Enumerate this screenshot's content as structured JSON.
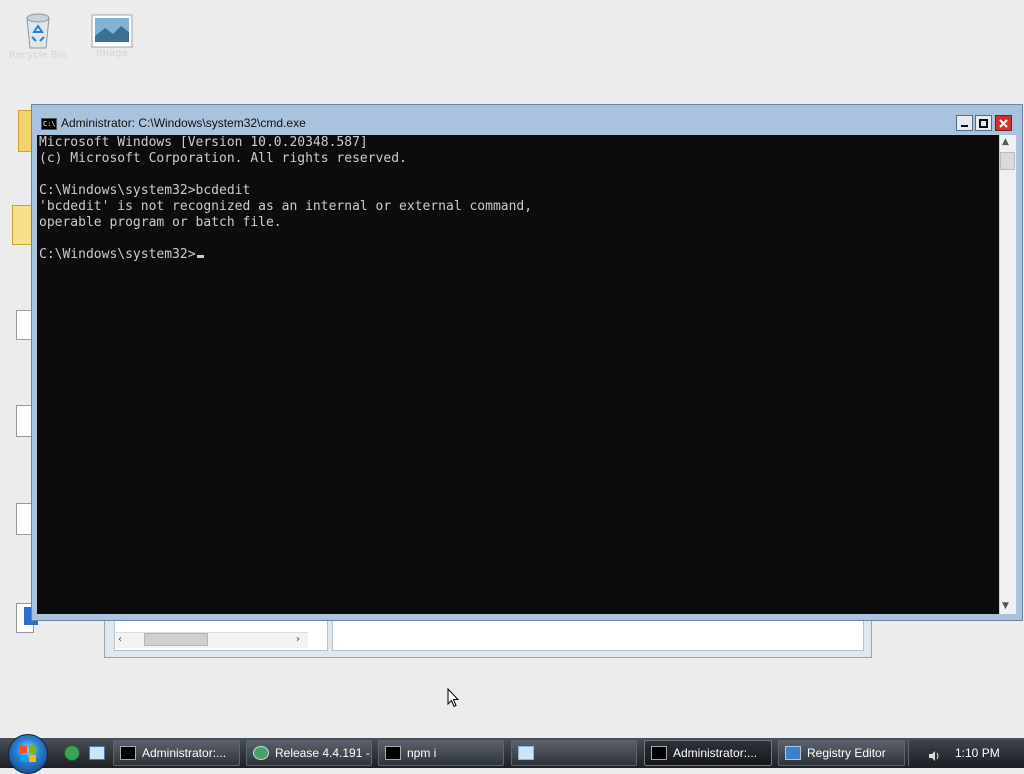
{
  "desktop": {
    "icons": [
      {
        "label": "Recycle Bin",
        "icon": "recycle-bin-icon"
      },
      {
        "label": "Image",
        "icon": "image-icon"
      }
    ]
  },
  "cmd": {
    "title": "Administrator: C:\\Windows\\system32\\cmd.exe",
    "icon_text": "C:\\",
    "lines": [
      "Microsoft Windows [Version 10.0.20348.587]",
      "(c) Microsoft Corporation. All rights reserved.",
      "",
      "C:\\Windows\\system32>bcdedit",
      "'bcdedit' is not recognized as an internal or external command,",
      "operable program or batch file.",
      ""
    ],
    "prompt": "C:\\Windows\\system32>"
  },
  "taskbar": {
    "items": [
      {
        "label": "Administrator:...",
        "icon": "cmd-icon"
      },
      {
        "label": "Release 4.4.191 -...",
        "icon": "globe-icon"
      },
      {
        "label": "npm i",
        "icon": "cmd-icon"
      },
      {
        "label": "",
        "icon": "window-icon"
      },
      {
        "label": "Administrator:...",
        "icon": "cmd-icon",
        "active": true
      },
      {
        "label": "Registry Editor",
        "icon": "registry-icon"
      }
    ],
    "clock": "1:10 PM"
  }
}
